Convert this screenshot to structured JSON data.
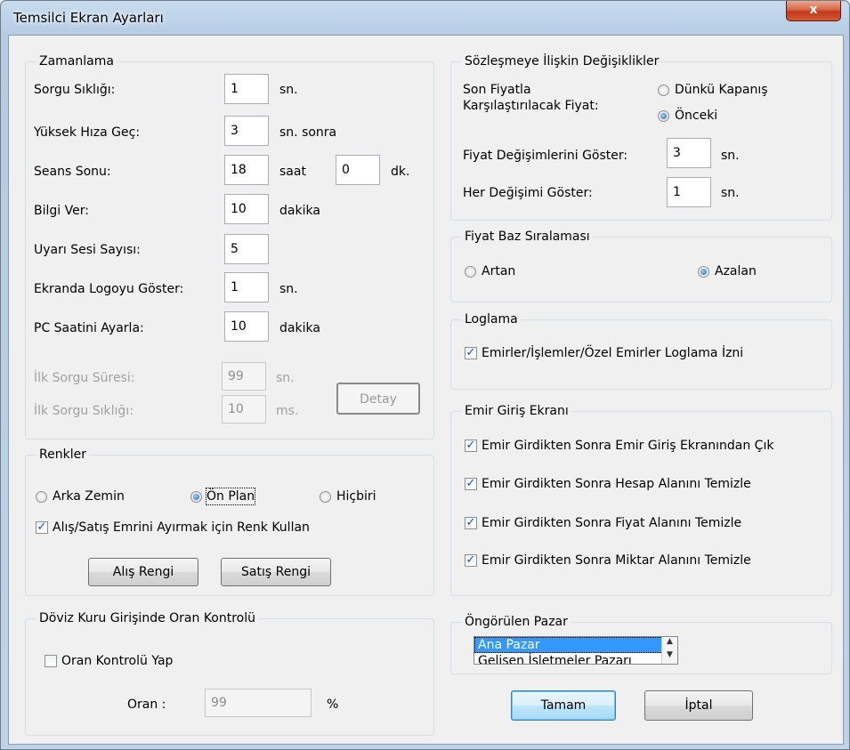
{
  "window": {
    "title": "Temsilci Ekran Ayarları",
    "close_glyph": "x"
  },
  "zamanlama": {
    "title": "Zamanlama",
    "sorgu_sikligi": {
      "label": "Sorgu Sıklığı:",
      "value": "1",
      "unit": "sn."
    },
    "yuksek_hiza": {
      "label": "Yüksek Hıza Geç:",
      "value": "3",
      "unit": "sn. sonra"
    },
    "seans_sonu": {
      "label": "Seans Sonu:",
      "hour": "18",
      "hour_unit": "saat",
      "minute": "0",
      "minute_unit": "dk."
    },
    "bilgi_ver": {
      "label": "Bilgi Ver:",
      "value": "10",
      "unit": "dakika"
    },
    "uyari_sesi": {
      "label": "Uyarı Sesi Sayısı:",
      "value": "5"
    },
    "logo_goster": {
      "label": "Ekranda Logoyu Göster:",
      "value": "1",
      "unit": "sn."
    },
    "pc_saati": {
      "label": "PC Saatini Ayarla:",
      "value": "10",
      "unit": "dakika"
    },
    "ilk_sorgu_suresi": {
      "label": "İlk Sorgu Süresi:",
      "value": "99",
      "unit": "sn."
    },
    "ilk_sorgu_sikligi": {
      "label": "İlk Sorgu Sıklığı:",
      "value": "10",
      "unit": "ms."
    },
    "detay_button": "Detay"
  },
  "renkler": {
    "title": "Renkler",
    "radio_arka": "Arka Zemin",
    "radio_on": "Ön Plan",
    "radio_hicbiri": "Hiçbiri",
    "selected": "on_plan",
    "renk_kullan": {
      "label": "Alış/Satış Emrini Ayırmak için Renk Kullan",
      "checked": true
    },
    "alis_rengi": "Alış Rengi",
    "satis_rengi": "Satış Rengi"
  },
  "doviz": {
    "title": "Döviz Kuru Girişinde Oran Kontrolü",
    "oran_kontrolu": {
      "label": "Oran Kontrolü Yap",
      "checked": false
    },
    "oran_label": "Oran :",
    "oran_value": "99",
    "oran_unit": "%"
  },
  "sozlesme": {
    "title": "Sözleşmeye İlişkin Değişiklikler",
    "karsilastirma_label_1": "Son Fiyatla",
    "karsilastirma_label_2": "Karşılaştırılacak Fiyat:",
    "radio_dunku": "Dünkü Kapanış",
    "radio_onceki": "Önceki",
    "selected": "onceki",
    "fiyat_degisim": {
      "label": "Fiyat Değişimlerini Göster:",
      "value": "3",
      "unit": "sn."
    },
    "her_degisim": {
      "label": "Her Değişimi Göster:",
      "value": "1",
      "unit": "sn."
    }
  },
  "fiyat_baz": {
    "title": "Fiyat Baz Sıralaması",
    "radio_artan": "Artan",
    "radio_azalan": "Azalan",
    "selected": "azalan"
  },
  "loglama": {
    "title": "Loglama",
    "izin": {
      "label": "Emirler/İşlemler/Özel Emirler Loglama İzni",
      "checked": true
    }
  },
  "emir_giris": {
    "title": "Emir Giriş Ekranı",
    "options": [
      {
        "label": "Emir Girdikten Sonra Emir Giriş Ekranından Çık",
        "checked": true
      },
      {
        "label": "Emir Girdikten Sonra Hesap Alanını Temizle",
        "checked": true
      },
      {
        "label": "Emir Girdikten Sonra Fiyat Alanını Temizle",
        "checked": true
      },
      {
        "label": "Emir Girdikten Sonra Miktar Alanını Temizle",
        "checked": true
      }
    ]
  },
  "ongorulen_pazar": {
    "title": "Öngörülen Pazar",
    "items": [
      "Ana Pazar",
      "Gelişen İşletmeler Pazarı"
    ],
    "selected_index": 0
  },
  "buttons": {
    "tamam": "Tamam",
    "iptal": "İptal"
  },
  "check_glyph": "✓"
}
